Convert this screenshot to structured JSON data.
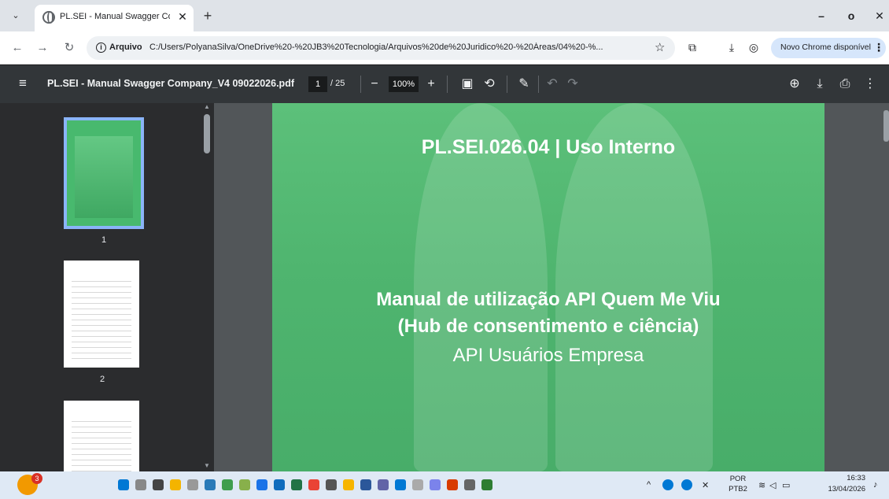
{
  "browser": {
    "tab_title": "PL.SEI - Manual Swagger Comp",
    "tab_close": "✕",
    "new_tab": "+",
    "window_controls": {
      "minimize": "–",
      "maximize": "o",
      "close": "✕"
    },
    "origin_label": "Arquivo",
    "url": "C:/Users/PolyanaSilva/OneDrive%20-%20JB3%20Tecnologia/Arquivos%20de%20Juridico%20-%20Áreas/04%20-%...",
    "update_label": "Novo Chrome disponível"
  },
  "pdf_toolbar": {
    "file_name": "PL.SEI - Manual Swagger Company_V4 09022026.pdf",
    "current_page": "1",
    "total_pages": "/ 25",
    "zoom": "100%"
  },
  "sidebar": {
    "thumbnails": [
      {
        "page": "1"
      },
      {
        "page": "2"
      }
    ]
  },
  "page": {
    "header": "PL.SEI.026.04 | Uso Interno",
    "title_line1": "Manual de utilização API Quem Me Viu",
    "title_line2": "(Hub de consentimento e ciência)",
    "subtitle": "API Usuários Empresa"
  },
  "taskbar": {
    "notification_count": "3",
    "lang_primary": "POR",
    "lang_secondary": "PTB2",
    "time": "16:33",
    "date": "13/04/2026"
  },
  "colors": {
    "accent": "#8ab4f8",
    "pdf_green": "#4fb56f",
    "toolbar": "#323639"
  }
}
